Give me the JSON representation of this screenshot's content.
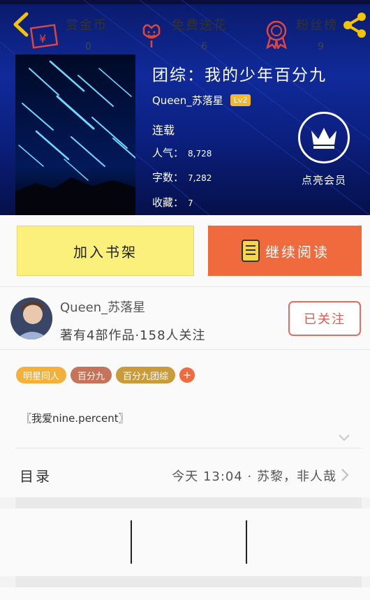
{
  "book": {
    "title": "团综：我的少年百分九",
    "author": "Queen_苏落星",
    "level": "Lv2",
    "status": "连载",
    "popularity_label": "人气：",
    "popularity": "8,728",
    "words_label": "字数：",
    "words": "7,282",
    "favorites_label": "收藏：",
    "favorites": "7"
  },
  "vip": {
    "label": "点亮会员",
    "icon": "crown-icon"
  },
  "buttons": {
    "shelf": "加入书架",
    "read": "继续阅读"
  },
  "author_card": {
    "name": "Queen_苏落星",
    "meta": "著有4部作品·158人关注",
    "follow": "已关注"
  },
  "tags": [
    {
      "label": "明星同人",
      "color": "#f3b03a"
    },
    {
      "label": "百分九",
      "color": "#c4745a"
    },
    {
      "label": "百分九团综",
      "color": "#c99b3a"
    }
  ],
  "tag_add": "+",
  "description": "〖我爱nine.percent〗",
  "toc": {
    "label": "目录",
    "latest": "今天 13:04 · 苏黎，非人哉"
  },
  "actions": [
    {
      "label": "赏金币",
      "count": "0",
      "icon": "red-envelope-icon"
    },
    {
      "label": "免费送花",
      "count": "6",
      "icon": "flower-icon"
    },
    {
      "label": "粉丝榜",
      "count": "9",
      "icon": "medal-icon"
    }
  ],
  "colors": {
    "accent": "#ef6a3c",
    "shelf": "#fbf07b",
    "icon_red": "#e0463c"
  }
}
